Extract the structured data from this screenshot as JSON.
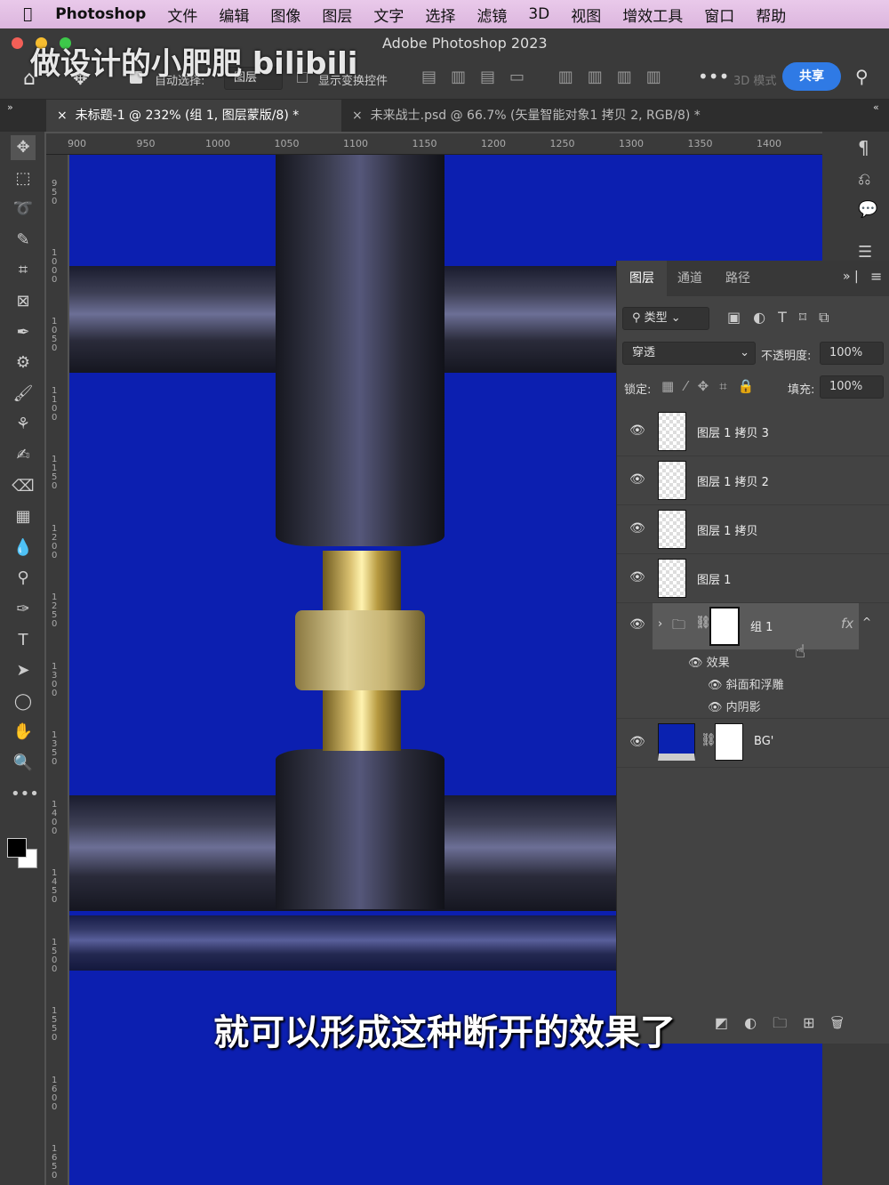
{
  "menubar": {
    "app": "Photoshop",
    "items": [
      "文件",
      "编辑",
      "图像",
      "图层",
      "文字",
      "选择",
      "滤镜",
      "3D",
      "视图",
      "增效工具",
      "窗口",
      "帮助"
    ]
  },
  "window": {
    "title": "Adobe Photoshop 2023"
  },
  "watermark": {
    "text": "做设计的小肥肥 bilibili"
  },
  "options": {
    "auto_select_label": "自动选择:",
    "auto_select_value": "图层",
    "show_transform": "显示变换控件",
    "mode_3d": "3D 模式",
    "share": "共享"
  },
  "tabs": [
    {
      "label": "未标题-1 @ 232% (组 1, 图层蒙版/8) *",
      "active": true
    },
    {
      "label": "未来战士.psd @ 66.7% (矢量智能对象1 拷贝 2, RGB/8) *",
      "active": false
    }
  ],
  "ruler": {
    "h": [
      "900",
      "950",
      "1000",
      "1050",
      "1100",
      "1150",
      "1200",
      "1250",
      "1300",
      "1350",
      "1400"
    ],
    "v": [
      "950",
      "1000",
      "1050",
      "1100",
      "1150",
      "1200",
      "1250",
      "1300",
      "1350",
      "1400",
      "1450",
      "1500",
      "1550",
      "1600",
      "1650"
    ]
  },
  "canvas": {
    "background": "#0c1fb0"
  },
  "layers_panel": {
    "tabs": [
      "图层",
      "通道",
      "路径"
    ],
    "filter": "类型",
    "blend_mode": "穿透",
    "opacity_label": "不透明度:",
    "opacity": "100%",
    "lock_label": "锁定:",
    "fill_label": "填充:",
    "fill": "100%",
    "layers": [
      {
        "name": "图层 1 拷贝 3"
      },
      {
        "name": "图层 1 拷贝 2"
      },
      {
        "name": "图层 1 拷贝"
      },
      {
        "name": "图层 1"
      }
    ],
    "group": {
      "name": "组 1",
      "fx": "fx",
      "effects_label": "效果",
      "effects": [
        "斜面和浮雕",
        "内阴影"
      ]
    },
    "bg": {
      "name": "BG'"
    }
  },
  "subtitle": "就可以形成这种断开的效果了"
}
